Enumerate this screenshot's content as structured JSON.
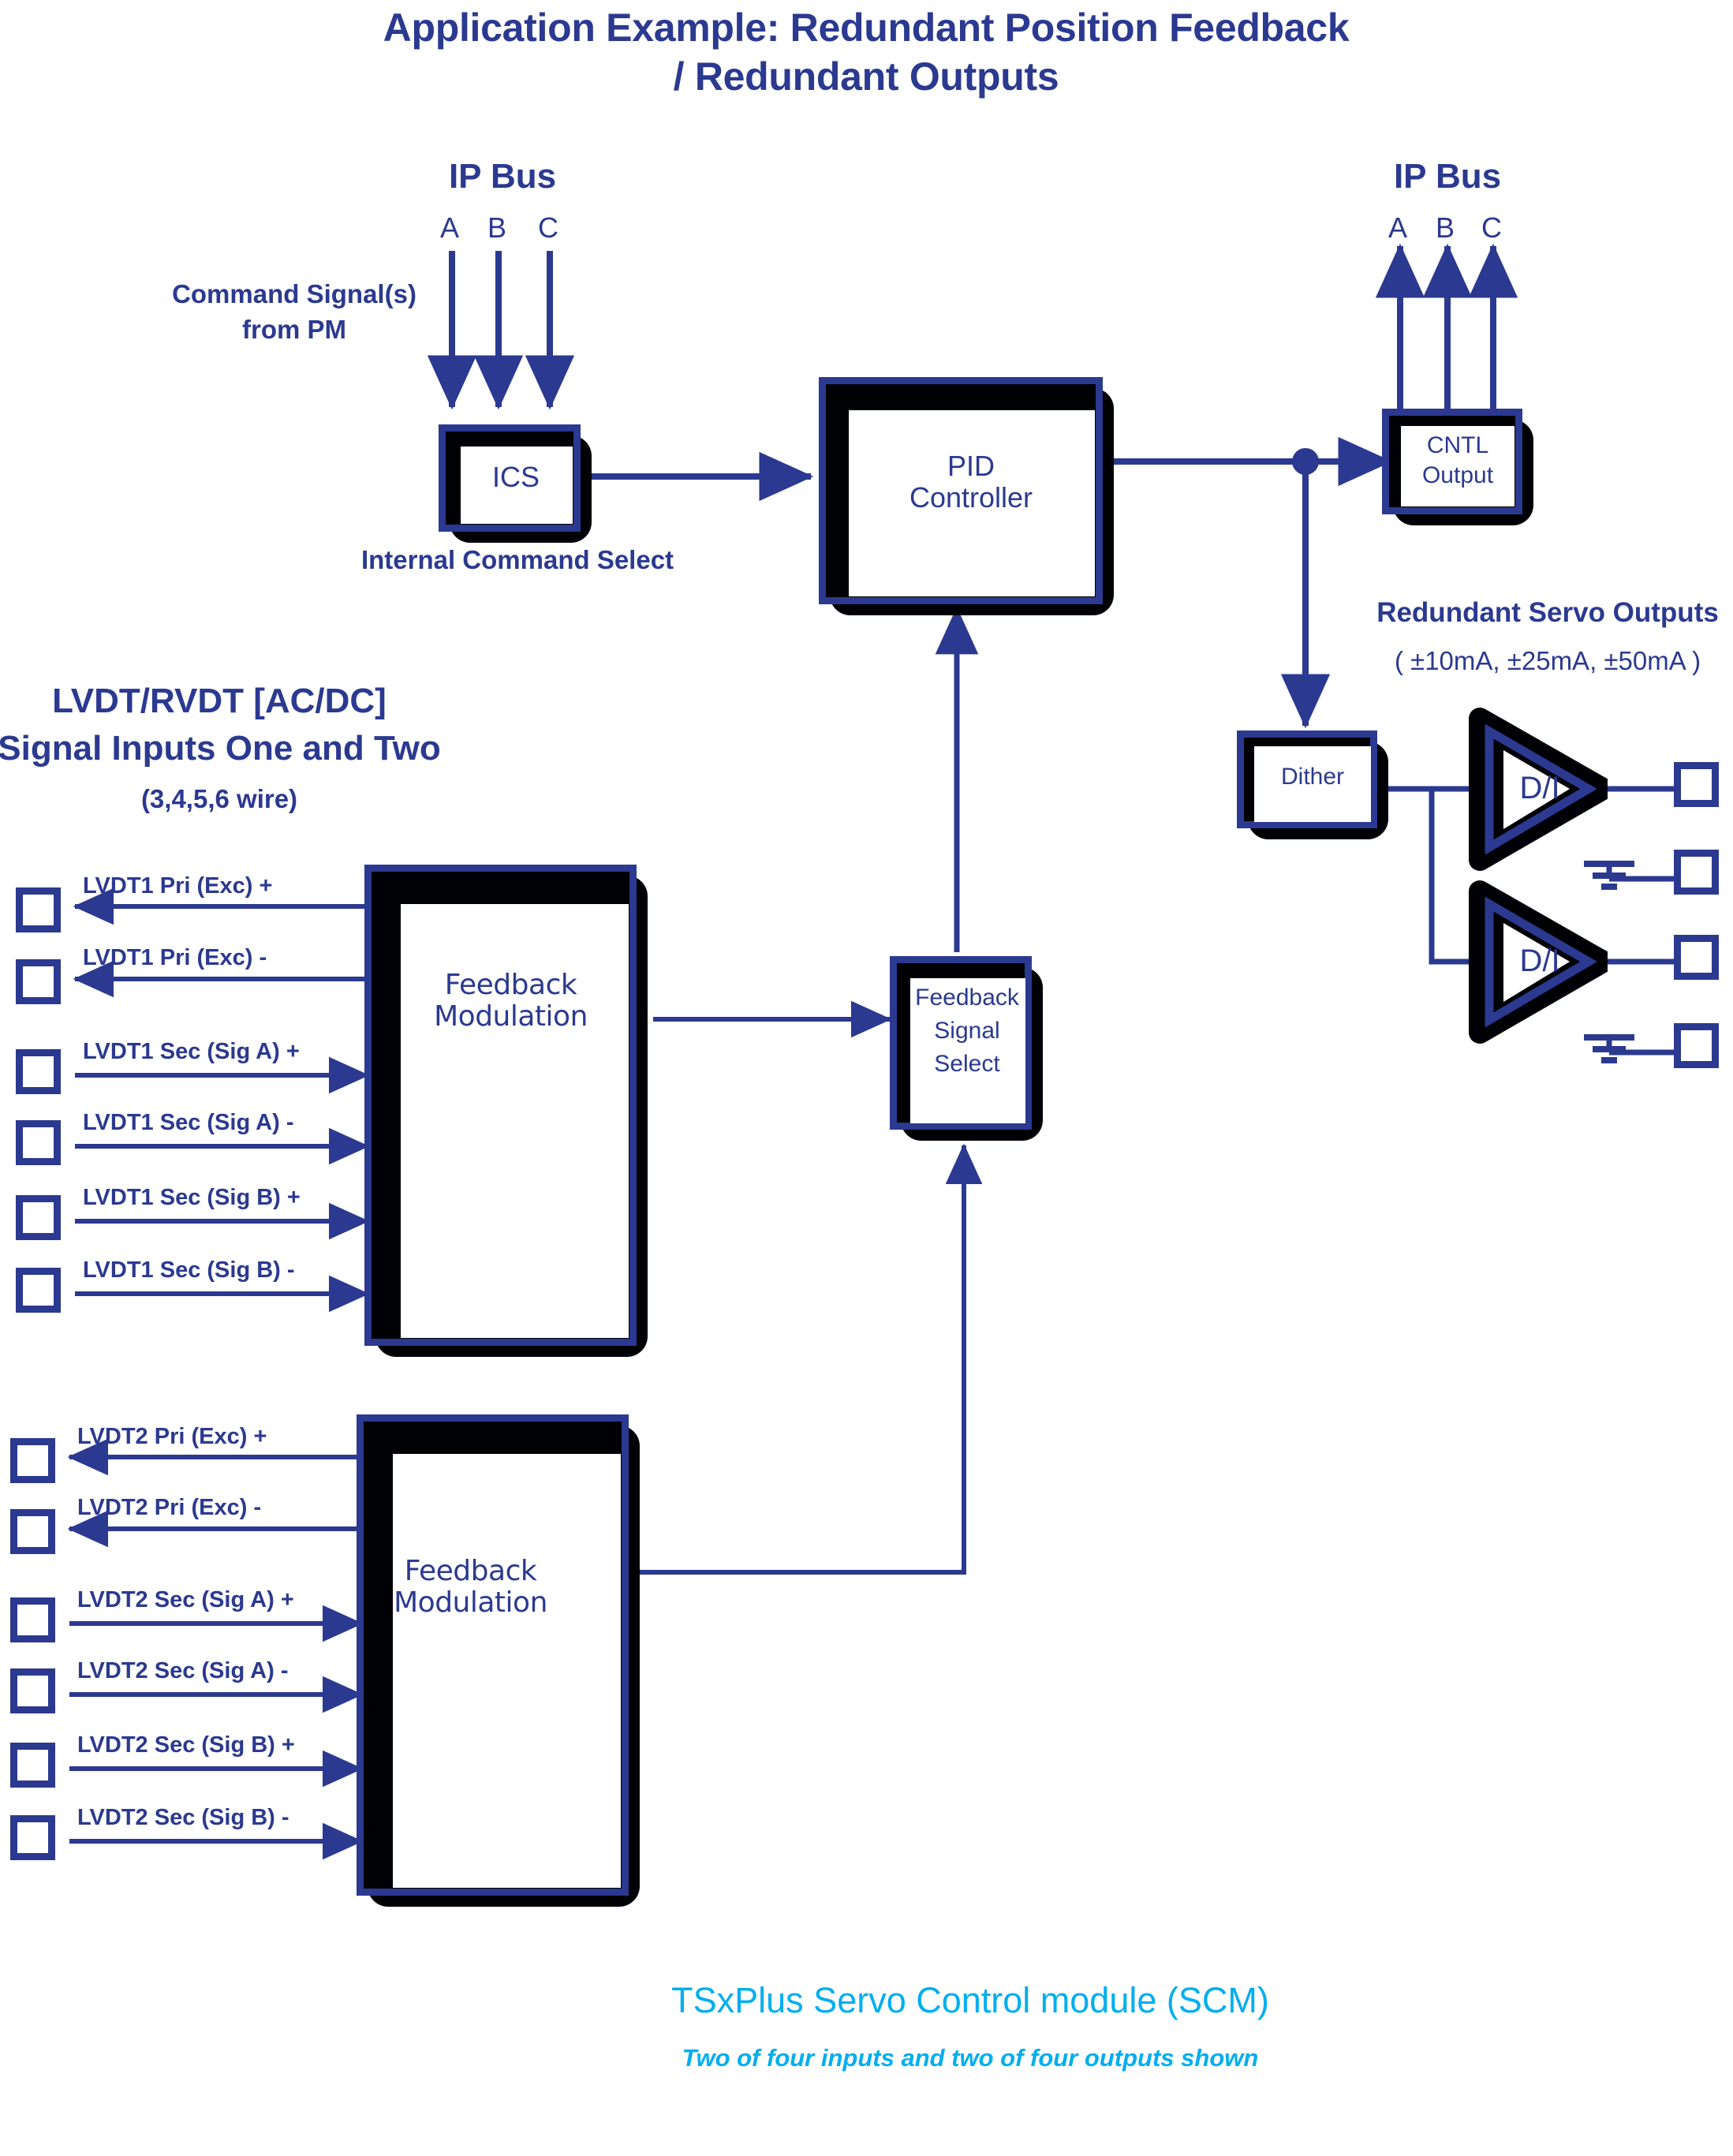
{
  "title": {
    "line1": "Application Example: Redundant Position Feedback",
    "line2": "/ Redundant Outputs"
  },
  "colors": {
    "primary_blue": "#2B3990",
    "accent_cyan": "#00AEEF",
    "shadow_black": "#000105",
    "background": "#FFFFFF"
  },
  "input_bus": {
    "label": "IP Bus",
    "lines": [
      "A",
      "B",
      "C"
    ],
    "command_note_line1": "Command Signal(s)",
    "command_note_line2": "from PM"
  },
  "output_bus": {
    "label": "IP Bus",
    "lines": [
      "A",
      "B",
      "C"
    ]
  },
  "blocks": {
    "ics": {
      "label": "ICS",
      "caption": "Internal Command Select"
    },
    "pid": {
      "label_line1": "PID",
      "label_line2": "Controller"
    },
    "cntl_output": {
      "label_line1": "CNTL",
      "label_line2": "Output"
    },
    "dither": {
      "label": "Dither"
    },
    "feedback_signal_select": {
      "label_line1": "Feedback",
      "label_line2": "Signal",
      "label_line3": "Select"
    },
    "feedback_modulation_1": {
      "label_line1": "Feedback",
      "label_line2": "Modulation"
    },
    "feedback_modulation_2": {
      "label_line1": "Feedback",
      "label_line2": "Modulation"
    }
  },
  "servo_outputs": {
    "header": "Redundant Servo Outputs",
    "ranges": "( ±10mA, ±25mA, ±50mA )",
    "amplifiers": [
      {
        "label": "D/I"
      },
      {
        "label": "D/I"
      }
    ],
    "terminals": [
      {
        "name": "output-1-signal",
        "grounded": false
      },
      {
        "name": "output-1-return",
        "grounded": true
      },
      {
        "name": "output-2-signal",
        "grounded": false
      },
      {
        "name": "output-2-return",
        "grounded": true
      }
    ]
  },
  "signal_inputs": {
    "header_line1": "LVDT/RVDT [AC/DC]",
    "header_line2": "Signal Inputs One and Two",
    "header_line3": "(3,4,5,6 wire)",
    "group_one": [
      {
        "label": "LVDT1 Pri (Exc) +",
        "direction": "out"
      },
      {
        "label": "LVDT1 Pri (Exc) -",
        "direction": "out"
      },
      {
        "label": "LVDT1 Sec (Sig A) +",
        "direction": "in"
      },
      {
        "label": "LVDT1 Sec (Sig A) -",
        "direction": "in"
      },
      {
        "label": "LVDT1 Sec (Sig B) +",
        "direction": "in"
      },
      {
        "label": "LVDT1 Sec (Sig B) -",
        "direction": "in"
      }
    ],
    "group_two": [
      {
        "label": "LVDT2 Pri (Exc) +",
        "direction": "out"
      },
      {
        "label": "LVDT2 Pri (Exc) -",
        "direction": "out"
      },
      {
        "label": "LVDT2 Sec (Sig A) +",
        "direction": "in"
      },
      {
        "label": "LVDT2 Sec (Sig A) -",
        "direction": "in"
      },
      {
        "label": "LVDT2 Sec (Sig B) +",
        "direction": "in"
      },
      {
        "label": "LVDT2 Sec (Sig B) -",
        "direction": "in"
      }
    ]
  },
  "footer": {
    "caption": "TSxPlus Servo Control module (SCM)",
    "subcaption": "Two of four inputs and two of four outputs shown"
  }
}
